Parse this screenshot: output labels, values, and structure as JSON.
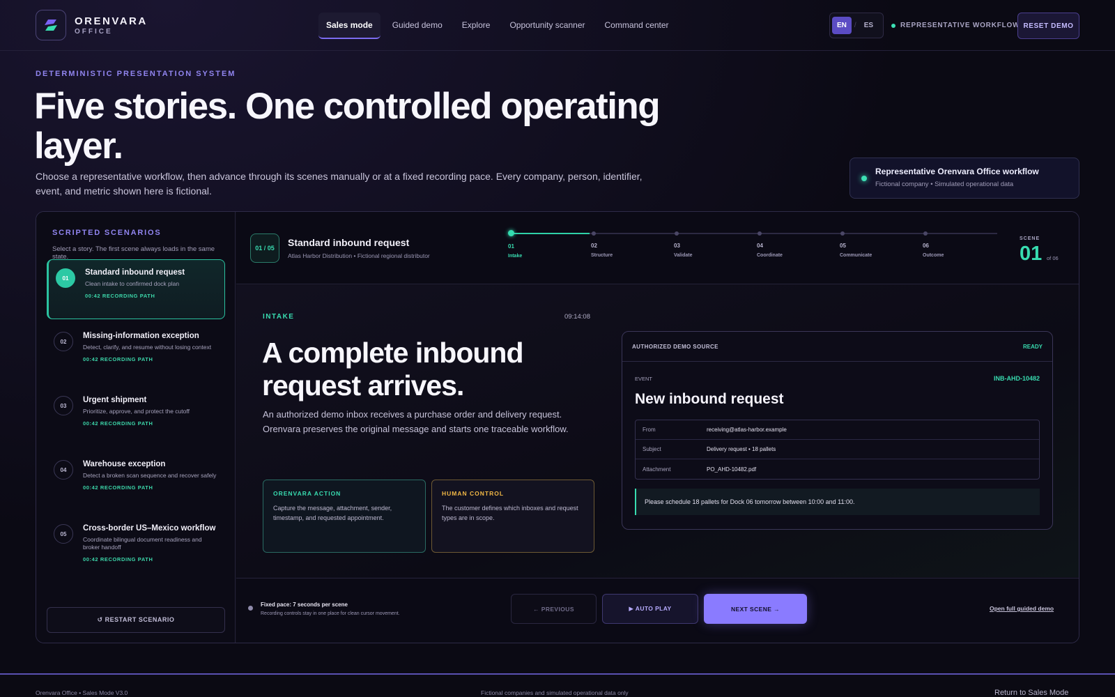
{
  "brand": {
    "name": "ORENVARA",
    "sub": "OFFICE"
  },
  "nav": [
    "Sales mode",
    "Guided demo",
    "Explore",
    "Opportunity scanner",
    "Command center"
  ],
  "lang": {
    "en": "EN",
    "sep": "/",
    "es": "ES"
  },
  "status": "REPRESENTATIVE WORKFLOW",
  "reset_label": "RESET DEMO",
  "hero": {
    "eyebrow": "DETERMINISTIC PRESENTATION SYSTEM",
    "title": "Five stories. One controlled operating layer.",
    "subtitle": "Choose a representative workflow, then advance through its scenes manually or at a fixed recording pace. Every company, person, identifier, event, and metric shown here is fictional."
  },
  "rep_card": {
    "title": "Representative Orenvara Office workflow",
    "sub": "Fictional company • Simulated operational data"
  },
  "sidebar": {
    "heading": "SCRIPTED SCENARIOS",
    "sub": "Select a story. The first scene always loads in the same state.",
    "scenarios": [
      {
        "num": "01",
        "name": "Standard inbound request",
        "desc": "Clean intake to confirmed dock plan",
        "path": "00:42 RECORDING PATH"
      },
      {
        "num": "02",
        "name": "Missing-information exception",
        "desc": "Detect, clarify, and resume without losing context",
        "path": "00:42 RECORDING PATH"
      },
      {
        "num": "03",
        "name": "Urgent shipment",
        "desc": "Prioritize, approve, and protect the cutoff",
        "path": "00:42 RECORDING PATH"
      },
      {
        "num": "04",
        "name": "Warehouse exception",
        "desc": "Detect a broken scan sequence and recover safely",
        "path": "00:42 RECORDING PATH"
      },
      {
        "num": "05",
        "name": "Cross-border US–Mexico workflow",
        "desc": "Coordinate bilingual document readiness and broker handoff",
        "path": "00:42 RECORDING PATH"
      }
    ],
    "restart_label": "↺ RESTART SCENARIO"
  },
  "stage_head": {
    "badge": "01 / 05",
    "title": "Standard inbound request",
    "sub": "Atlas Harbor Distribution • Fictional regional distributor",
    "steps": [
      {
        "n": "01",
        "label": "Intake"
      },
      {
        "n": "02",
        "label": "Structure"
      },
      {
        "n": "03",
        "label": "Validate"
      },
      {
        "n": "04",
        "label": "Coordinate"
      },
      {
        "n": "05",
        "label": "Communicate"
      },
      {
        "n": "06",
        "label": "Outcome"
      }
    ],
    "scene_label": "SCENE",
    "scene_num": "01",
    "scene_of": "of 06"
  },
  "stage": {
    "kicker": "INTAKE",
    "time": "09:14:08",
    "title": "A complete inbound request arrives.",
    "desc": "An authorized demo inbox receives a purchase order and delivery request. Orenvara preserves the original message and starts one traceable workflow.",
    "action": {
      "kicker": "ORENVARA ACTION",
      "body": "Capture the message, attachment, sender, timestamp, and requested appointment."
    },
    "human": {
      "kicker": "HUMAN CONTROL",
      "body": "The customer defines which inboxes and request types are in scope."
    },
    "source": {
      "title": "AUTHORIZED DEMO SOURCE",
      "ready": "READY",
      "event_label": "EVENT",
      "event_id": "INB-AHD-10482",
      "event_title": "New inbound request",
      "rows": [
        {
          "k": "From",
          "v": "receiving@atlas-harbor.example"
        },
        {
          "k": "Subject",
          "v": "Delivery request • 18 pallets"
        },
        {
          "k": "Attachment",
          "v": "PO_AHD-10482.pdf"
        }
      ],
      "quote": "Please schedule 18 pallets for Dock 06 tomorrow between 10:00 and 11:00."
    }
  },
  "controls": {
    "pace_title": "Fixed pace: 7 seconds per scene",
    "pace_sub": "Recording controls stay in one place for clean cursor movement.",
    "prev": "← PREVIOUS",
    "auto": "▶ AUTO PLAY",
    "next": "NEXT SCENE →",
    "full_link": "Open full guided demo"
  },
  "footer": {
    "left": "Orenvara Office • Sales Mode V3.0",
    "center": "Fictional companies and simulated operational data only",
    "right": "Return to Sales Mode"
  },
  "colors": {
    "accent": "#8a7bff",
    "teal": "#38dcb0",
    "amber": "#f2b845",
    "bg": "#0b0a14"
  }
}
